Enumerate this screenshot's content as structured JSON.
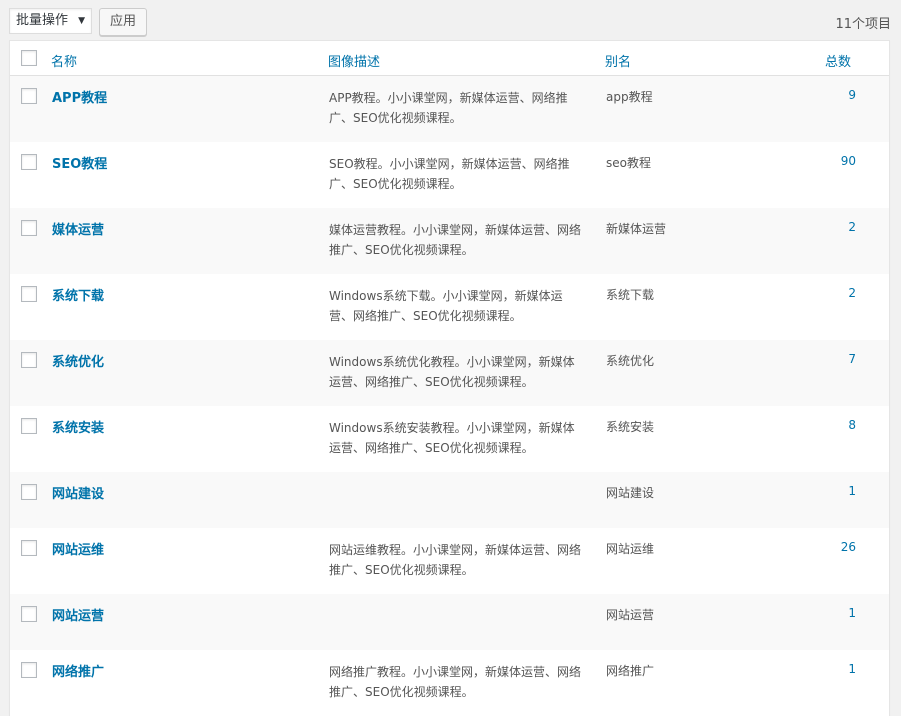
{
  "tablenav": {
    "bulk_action_label": "批量操作",
    "apply_label": "应用",
    "items_count": "11个项目"
  },
  "table": {
    "columns": {
      "name": "名称",
      "description": "图像描述",
      "slug": "别名",
      "count": "总数"
    },
    "rows": [
      {
        "name": "APP教程",
        "description": "APP教程。小小课堂网，新媒体运营、网络推广、SEO优化视频课程。",
        "slug": "app教程",
        "count": "9"
      },
      {
        "name": "SEO教程",
        "description": "SEO教程。小小课堂网，新媒体运营、网络推广、SEO优化视频课程。",
        "slug": "seo教程",
        "count": "90"
      },
      {
        "name": "媒体运营",
        "description": "媒体运营教程。小小课堂网，新媒体运营、网络推广、SEO优化视频课程。",
        "slug": "新媒体运营",
        "count": "2"
      },
      {
        "name": "系统下载",
        "description": "Windows系统下载。小小课堂网，新媒体运营、网络推广、SEO优化视频课程。",
        "slug": "系统下载",
        "count": "2"
      },
      {
        "name": "系统优化",
        "description": "Windows系统优化教程。小小课堂网，新媒体运营、网络推广、SEO优化视频课程。",
        "slug": "系统优化",
        "count": "7"
      },
      {
        "name": "系统安装",
        "description": "Windows系统安装教程。小小课堂网，新媒体运营、网络推广、SEO优化视频课程。",
        "slug": "系统安装",
        "count": "8"
      },
      {
        "name": "网站建设",
        "description": "",
        "slug": "网站建设",
        "count": "1"
      },
      {
        "name": "网站运维",
        "description": "网站运维教程。小小课堂网，新媒体运营、网络推广、SEO优化视频课程。",
        "slug": "网站运维",
        "count": "26"
      },
      {
        "name": "网站运营",
        "description": "",
        "slug": "网站运营",
        "count": "1"
      },
      {
        "name": "网络推广",
        "description": "网络推广教程。小小课堂网，新媒体运营、网络推广、SEO优化视频课程。",
        "slug": "网络推广",
        "count": "1"
      }
    ]
  }
}
